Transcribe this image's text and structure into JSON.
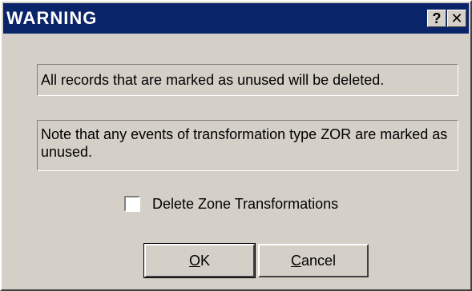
{
  "window": {
    "title": "WARNING",
    "help_glyph": "?",
    "close_glyph": "✕"
  },
  "messages": {
    "primary": "All records that are marked as unused will be deleted.",
    "note": "Note that any events of transformation type ZOR are marked as unused."
  },
  "options": {
    "delete_zone_label": "Delete Zone Transformations",
    "delete_zone_checked": false
  },
  "buttons": {
    "ok_mnemonic": "O",
    "ok_rest": "K",
    "cancel_mnemonic": "C",
    "cancel_rest": "ancel"
  },
  "icons": {
    "help": "help-icon",
    "close": "close-icon"
  },
  "colors": {
    "titlebar": "#0a246a",
    "face": "#d4d0c8"
  }
}
